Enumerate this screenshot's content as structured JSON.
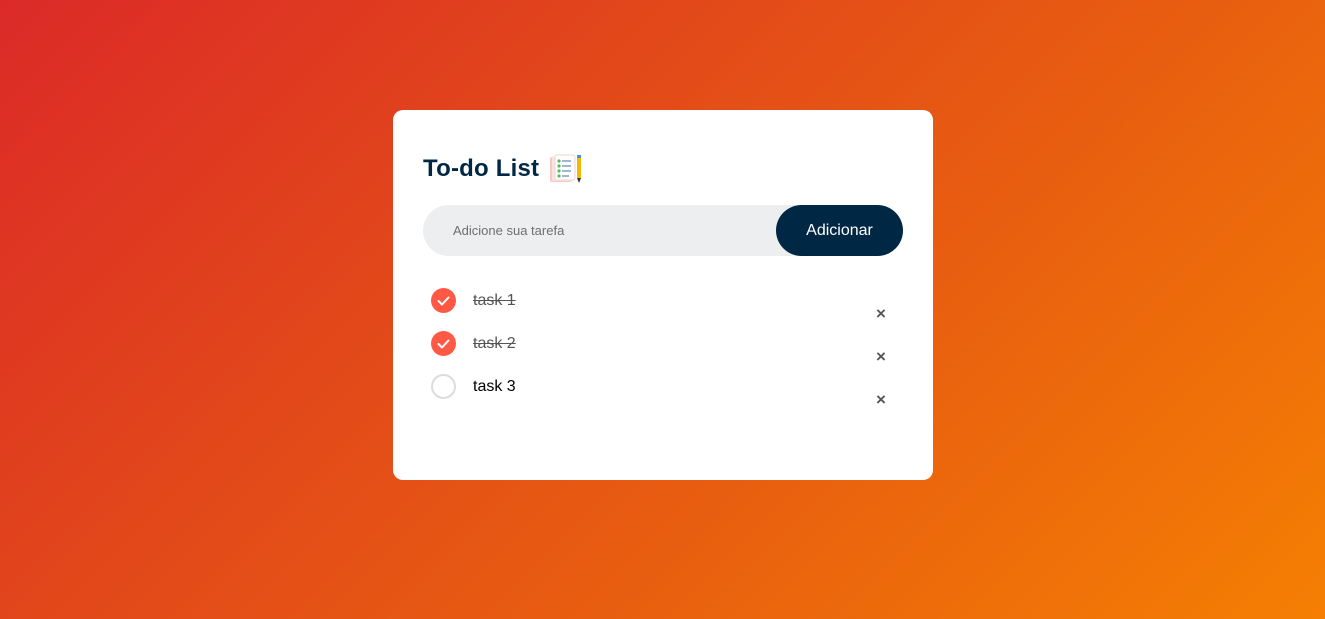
{
  "app": {
    "title": "To-do List",
    "title_icon": "notepad-checklist-icon"
  },
  "input": {
    "placeholder": "Adicione sua tarefa",
    "value": ""
  },
  "add_button": {
    "label": "Adicionar"
  },
  "tasks": [
    {
      "text": "task 1",
      "checked": true
    },
    {
      "text": "task 2",
      "checked": true
    },
    {
      "text": "task 3",
      "checked": false
    }
  ],
  "delete_glyph": "×",
  "colors": {
    "background_start": "#dc2a28",
    "background_end": "#f57f03",
    "title": "#002845",
    "button": "#002845",
    "checked": "#ff5945",
    "input_bg": "#edeef0"
  }
}
